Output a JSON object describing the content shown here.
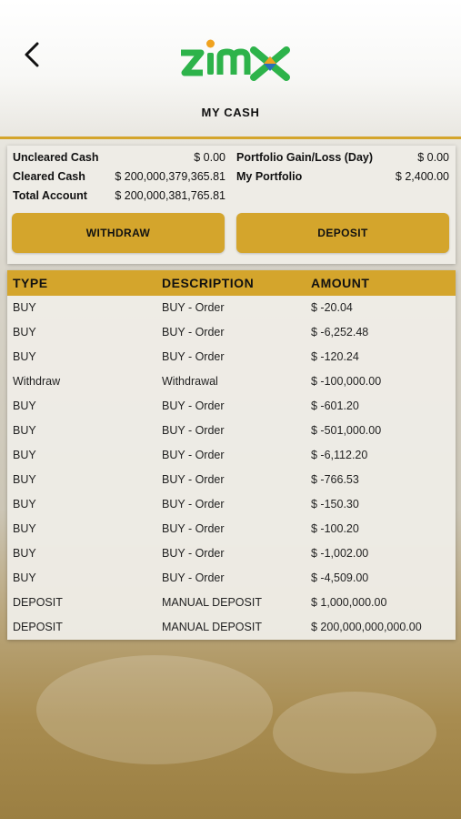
{
  "header": {
    "back_icon": "chevron-left-icon",
    "logo": "zimx",
    "title": "MY CASH"
  },
  "summary": {
    "left": [
      {
        "label": "Uncleared Cash",
        "value": "$ 0.00"
      },
      {
        "label": "Cleared Cash",
        "value": "$ 200,000,379,365.81"
      },
      {
        "label": "Total Account",
        "value": "$ 200,000,381,765.81"
      }
    ],
    "right": [
      {
        "label": "Portfolio Gain/Loss (Day)",
        "value": "$ 0.00"
      },
      {
        "label": "My Portfolio",
        "value": "$ 2,400.00"
      }
    ],
    "withdraw_label": "WITHDRAW",
    "deposit_label": "DEPOSIT"
  },
  "table": {
    "columns": [
      "TYPE",
      "DESCRIPTION",
      "AMOUNT"
    ],
    "rows": [
      [
        "BUY",
        "BUY - Order",
        "$ -20.04"
      ],
      [
        "BUY",
        "BUY - Order",
        "$ -6,252.48"
      ],
      [
        "BUY",
        "BUY - Order",
        "$ -120.24"
      ],
      [
        "Withdraw",
        "Withdrawal",
        "$ -100,000.00"
      ],
      [
        "BUY",
        "BUY - Order",
        "$ -601.20"
      ],
      [
        "BUY",
        "BUY - Order",
        "$ -501,000.00"
      ],
      [
        "BUY",
        "BUY - Order",
        "$ -6,112.20"
      ],
      [
        "BUY",
        "BUY - Order",
        "$ -766.53"
      ],
      [
        "BUY",
        "BUY - Order",
        "$ -150.30"
      ],
      [
        "BUY",
        "BUY - Order",
        "$ -100.20"
      ],
      [
        "BUY",
        "BUY - Order",
        "$ -1,002.00"
      ],
      [
        "BUY",
        "BUY - Order",
        "$ -4,509.00"
      ],
      [
        "DEPOSIT",
        "MANUAL DEPOSIT",
        "$ 1,000,000.00"
      ],
      [
        "DEPOSIT",
        "MANUAL DEPOSIT",
        "$ 200,000,000,000.00"
      ]
    ]
  },
  "colors": {
    "accent": "#d4a52c",
    "logo_green": "#2db34a",
    "logo_blue": "#2a6fb8",
    "logo_orange": "#f0a21e"
  }
}
